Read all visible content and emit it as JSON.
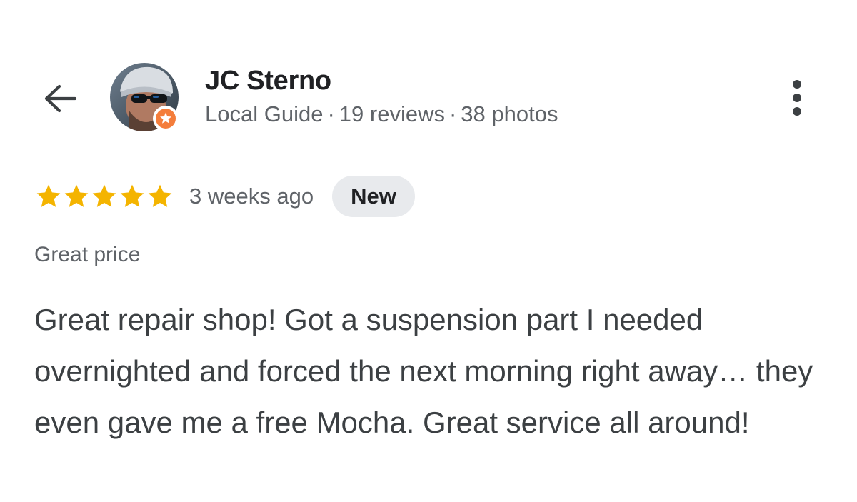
{
  "header": {
    "back_icon": "arrow-left-icon",
    "more_icon": "more-vertical-icon"
  },
  "reviewer": {
    "name": "JC Sterno",
    "avatar_icon": "avatar-photo",
    "badge_icon": "local-guide-star-icon",
    "badge_color": "#f47d3b",
    "meta": {
      "guide_label": "Local Guide",
      "separator": "·",
      "reviews": "19 reviews",
      "photos": "38 photos"
    }
  },
  "review": {
    "rating": 5,
    "rating_max": 5,
    "star_color": "#f4b400",
    "time_ago": "3 weeks ago",
    "badge": "New",
    "tag": "Great price",
    "text": "Great repair shop! Got a suspension part I needed overnighted and forced the next morning right away… they even gave me a free Mocha. Great service all around!"
  }
}
